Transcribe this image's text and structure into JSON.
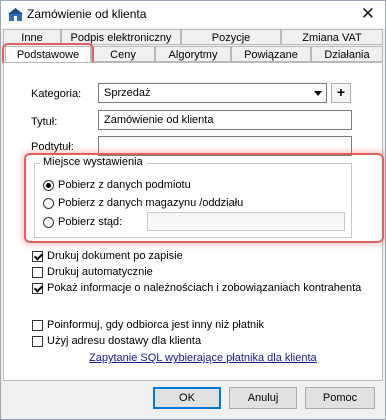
{
  "window": {
    "title": "Zamówienie od klienta"
  },
  "tabs_row1": [
    {
      "label": "Inne"
    },
    {
      "label": "Podpis elektroniczny"
    },
    {
      "label": "Pozycje"
    },
    {
      "label": "Zmiana VAT"
    }
  ],
  "tabs_row2": [
    {
      "label": "Podstawowe",
      "active": true
    },
    {
      "label": "Ceny"
    },
    {
      "label": "Algorytmy"
    },
    {
      "label": "Powiązane"
    },
    {
      "label": "Działania"
    }
  ],
  "form": {
    "kategoria_label": "Kategoria:",
    "kategoria_value": "Sprzedaż",
    "plus_label": "+",
    "tytul_label": "Tytuł:",
    "tytul_value": "Zamówienie od klienta",
    "podtytul_label": "Podtytuł:",
    "podtytul_value": ""
  },
  "miejsce": {
    "title": "Miejsce wystawienia",
    "options": [
      {
        "label": "Pobierz z danych podmiotu",
        "selected": true
      },
      {
        "label": "Pobierz z danych magazynu /oddziału",
        "selected": false
      },
      {
        "label": "Pobierz stąd:",
        "selected": false
      }
    ]
  },
  "checks": [
    {
      "label": "Drukuj dokument po zapisie",
      "checked": true
    },
    {
      "label": "Drukuj automatycznie",
      "checked": false
    },
    {
      "label": "Pokaż informacje o należnościach i zobowiązaniach kontrahenta",
      "checked": true
    },
    {
      "label": "Poinformuj, gdy odbiorca jest inny niż płatnik",
      "checked": false
    },
    {
      "label": "Użyj adresu dostawy dla klienta",
      "checked": false
    }
  ],
  "link": "Zapytanie SQL wybierające płatnika dla klienta",
  "buttons": {
    "ok": "OK",
    "cancel": "Anuluj",
    "help": "Pomoc"
  },
  "colors": {
    "highlight": "#e06060",
    "link": "#1a1a8c",
    "accent": "#0078d7"
  }
}
